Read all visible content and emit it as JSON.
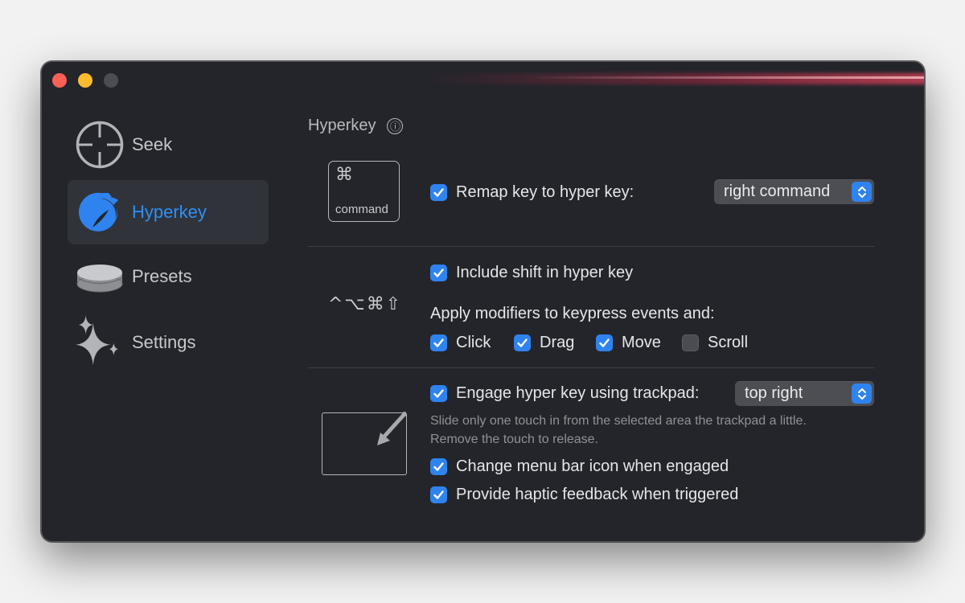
{
  "sidebar": {
    "items": [
      {
        "label": "Seek",
        "icon": "crosshair-icon",
        "active": false
      },
      {
        "label": "Hyperkey",
        "icon": "hyperkey-icon",
        "active": true
      },
      {
        "label": "Presets",
        "icon": "stack-icon",
        "active": false
      },
      {
        "label": "Settings",
        "icon": "sparkles-icon",
        "active": false
      }
    ]
  },
  "main": {
    "title": "Hyperkey",
    "info_icon": "ⓘ",
    "keycap": {
      "symbol": "⌘",
      "label": "command"
    },
    "remap": {
      "label": "Remap key to hyper key:",
      "checked": true,
      "selected": "right command"
    },
    "modifier_symbols": "^⌥⌘⇧",
    "include_shift": {
      "label": "Include shift in hyper key",
      "checked": true
    },
    "apply_label": "Apply modifiers to keypress events and:",
    "events": [
      {
        "label": "Click",
        "checked": true
      },
      {
        "label": "Drag",
        "checked": true
      },
      {
        "label": "Move",
        "checked": true
      },
      {
        "label": "Scroll",
        "checked": false
      }
    ],
    "trackpad": {
      "label": "Engage hyper key using trackpad:",
      "checked": true,
      "selected": "top right",
      "hint": "Slide only one touch in from the selected area the trackpad a little. Remove the touch to release."
    },
    "change_icon": {
      "label": "Change menu bar icon when engaged",
      "checked": true
    },
    "haptic": {
      "label": "Provide haptic feedback when triggered",
      "checked": true
    }
  },
  "colors": {
    "accent": "#2f83ee",
    "background": "#23252b",
    "close": "#fe5f57",
    "minimize": "#febc2e"
  }
}
